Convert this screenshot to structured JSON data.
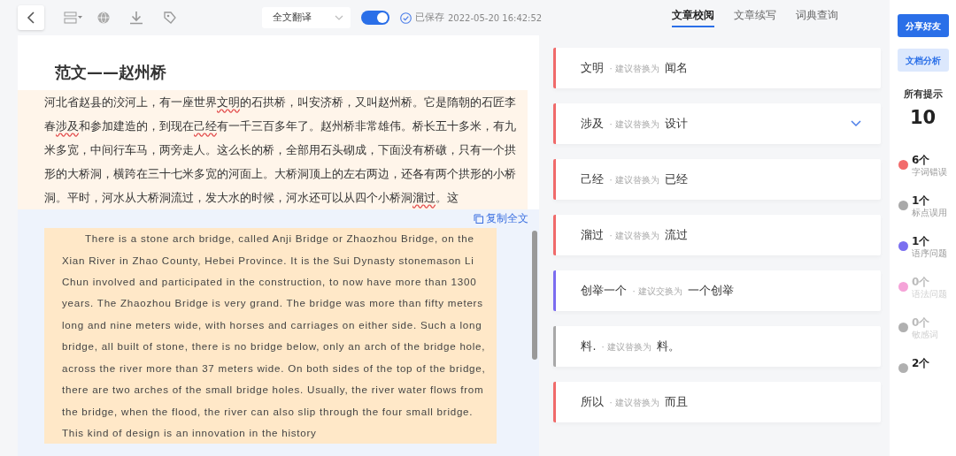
{
  "toolbar": {
    "mode_select": {
      "value": "全文翻译"
    },
    "translate_toggle": {
      "on": true
    },
    "save_status": {
      "label": "已保存",
      "time": "2022-05-20 16:42:52"
    }
  },
  "tabs": [
    {
      "label": "文章校阅",
      "selected": true
    },
    {
      "label": "文章续写",
      "selected": false
    },
    {
      "label": "词典查询",
      "selected": false
    }
  ],
  "document": {
    "title": "范文——赵州桥",
    "chinese_paragraph": [
      {
        "text": "河北省赵县的洨河上，有一座世界",
        "flagged": false
      },
      {
        "text": "文明",
        "flagged": true
      },
      {
        "text": "的石拱桥，叫安济桥，又叫赵州桥。它是隋朝的石匠李春",
        "flagged": false
      },
      {
        "text": "涉及",
        "flagged": true
      },
      {
        "text": "和参加建造的，到现在",
        "flagged": false
      },
      {
        "text": "己经",
        "flagged": true
      },
      {
        "text": "有一千三百多年了。赵州桥非常雄伟。桥长五十多米，有九米多宽，中间行车马，两旁走人。这么长的桥，全部用石头砌成，下面没有桥礅，只有一个拱形的大桥洞，横跨在三十七米多宽的河面上。大桥洞顶上的左右两边，还各有两个拱形的小桥洞。平时，河水从大桥洞流过，发大水的时候，河水还可以从四个小桥洞",
        "flagged": false
      },
      {
        "text": "溜过",
        "flagged": true
      },
      {
        "text": "。这",
        "flagged": false
      }
    ],
    "copy_link": "复制全文",
    "english_paragraph": "There is a stone arch bridge, called Anji Bridge or Zhaozhou Bridge, on the Xian River in Zhao County, Hebei Province. It is the Sui Dynasty stonemason Li Chun involved and participated in the construction, to now have more than 1300 years. The Zhaozhou Bridge is very grand. The bridge was more than fifty meters long and nine meters wide, with horses and carriages on either side. Such a long bridge, all built of stone, there is no bridge below, only an arch of the bridge hole, across the river more than 37 meters wide. On both sides of the top of the bridge, there are two arches of the small bridge holes. Usually, the river water flows from the bridge, when the flood, the river can also slip through the four small bridge. This kind of design is an innovation in the history"
  },
  "suggestions": [
    {
      "original": "文明",
      "hint": "· 建议替换为",
      "replacement": "闻名",
      "color": "#f06a6a",
      "expanded": false
    },
    {
      "original": "涉及",
      "hint": "· 建议替换为",
      "replacement": "设计",
      "color": "#f06a6a",
      "expanded": true
    },
    {
      "original": "己经",
      "hint": "· 建议替换为",
      "replacement": "已经",
      "color": "#f06a6a",
      "expanded": false
    },
    {
      "original": "溜过",
      "hint": "· 建议替换为",
      "replacement": "流过",
      "color": "#f06a6a",
      "expanded": false
    },
    {
      "original": "创举一个",
      "hint": "· 建议交换为",
      "replacement": "一个创举",
      "color": "#7b6cf0",
      "expanded": false
    },
    {
      "original": "料.",
      "hint": "· 建议替换为",
      "replacement": "料。",
      "color": "#a8a8a8",
      "expanded": false
    },
    {
      "original": "所以",
      "hint": "· 建议替换为",
      "replacement": "而且",
      "color": "#f06a6a",
      "expanded": false
    }
  ],
  "sidebar": {
    "share_button": "分享好友",
    "analysis_button": "文档分析",
    "total_label": "所有提示",
    "total": "10",
    "categories": [
      {
        "count": "6个",
        "label": "字词错误",
        "color": "#f26b6b",
        "disabled": false
      },
      {
        "count": "1个",
        "label": "标点误用",
        "color": "#a9a9a9",
        "disabled": false
      },
      {
        "count": "1个",
        "label": "语序问题",
        "color": "#7a6ff0",
        "disabled": false
      },
      {
        "count": "0个",
        "label": "语法问题",
        "color": "#f5a3d8",
        "disabled": true
      },
      {
        "count": "0个",
        "label": "敏感词",
        "color": "#b0b0b0",
        "disabled": true
      },
      {
        "count": "2个",
        "color": "#b0b0b0",
        "disabled": false
      }
    ]
  }
}
